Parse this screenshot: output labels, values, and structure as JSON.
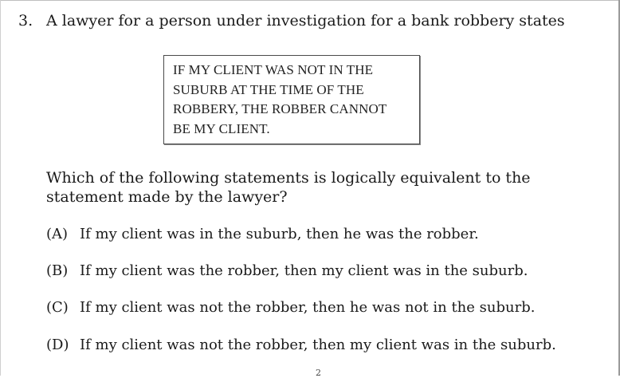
{
  "question": {
    "number": "3.",
    "stem": "A lawyer for a person under investigation for a bank robbery states",
    "quote": "IF MY CLIENT WAS NOT IN THE\nSUBURB AT THE TIME OF THE\nROBBERY, THE ROBBER CANNOT\nBE MY CLIENT.",
    "prompt": "Which of the following statements is logically equivalent to the statement made by the lawyer?",
    "options": [
      {
        "letter": "(A)",
        "text": "If my client was in the suburb, then he was the robber."
      },
      {
        "letter": "(B)",
        "text": "If my client was the robber, then my client was in the suburb."
      },
      {
        "letter": "(C)",
        "text": "If my client was not the robber, then he was not in the suburb."
      },
      {
        "letter": "(D)",
        "text": "If my client was not the robber, then my client was in the suburb."
      }
    ]
  },
  "footer_mark": "2"
}
